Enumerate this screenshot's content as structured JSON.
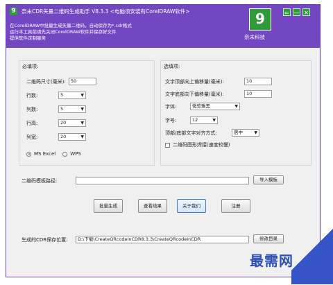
{
  "window": {
    "title": "奈末CDR矢量二维码生成助手 V8.3.3 <电脑须安装有CorelDRAW软件>",
    "logo_glyph": "9",
    "header_lines": [
      "在CorelDRAW中批量生成矢量二维码，自动保存为*.cdr格式",
      "运行本工具前请先关闭CorelDRAW软件并保存好文件",
      "提供软件定制服务"
    ],
    "brand_glyph": "9",
    "brand_name": "奈末科技",
    "controls": {
      "restore": "⇐",
      "minimize": "—",
      "close": "✕"
    },
    "accent": "#7447c2",
    "brand_green": "#2e9a3a"
  },
  "left_group": {
    "title": "必填项:",
    "qr_size_label": "二维码尺寸(毫米):",
    "qr_size_value": "50",
    "rows_label": "行数:",
    "rows_value": "5",
    "cols_label": "列数:",
    "cols_value": "5",
    "row_height_label": "行高:",
    "row_height_value": "20",
    "col_width_label": "列宽:",
    "col_width_value": "20",
    "radio_excel": "MS Excel",
    "radio_wps": "WPS"
  },
  "right_group": {
    "title": "选填项:",
    "top_offset_label": "文字顶部向上偏移量(毫米):",
    "top_offset_value": "10",
    "bottom_offset_label": "文字底部向下偏移量(毫米):",
    "bottom_offset_value": "10",
    "font_label": "字体:",
    "font_value": "微软雅黑",
    "size_label": "字号:",
    "size_value": "12",
    "align_label": "顶部/底部文字对齐方式:",
    "align_value": "居中",
    "graphic_label": "二维码图形焊接(速度较慢)"
  },
  "template": {
    "label": "二维码模板路径:",
    "path_value": "",
    "import_button": "导入模板"
  },
  "actions": {
    "batch": "批量生成",
    "view": "查看结果",
    "about": "关于我们",
    "register": "注册"
  },
  "save": {
    "label": "生成的CDR保存位置:",
    "path_value": "D:\\下载\\CreateQRcodeInCDR8.3.3\\CreateQRcodeInCDR",
    "modify_button": "修改目录"
  },
  "watermark": "最需网"
}
